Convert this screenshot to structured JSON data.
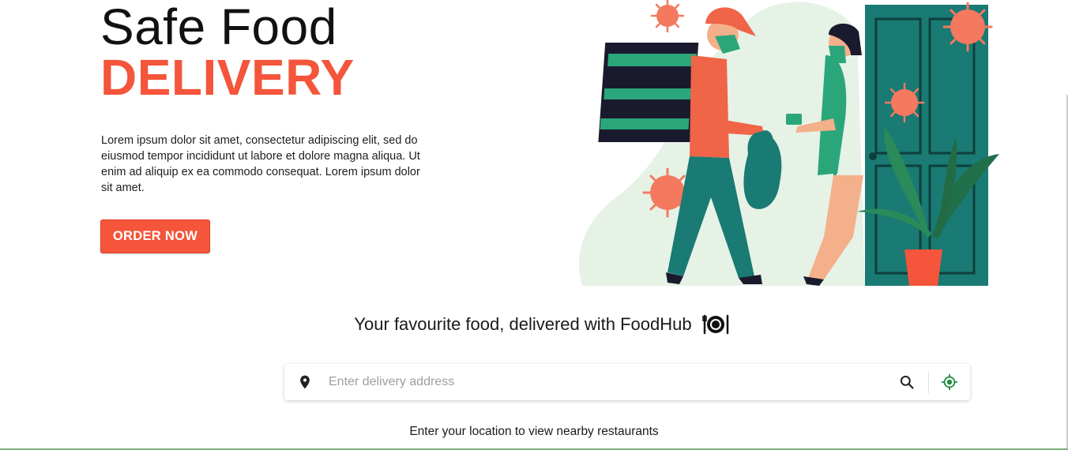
{
  "hero": {
    "title_line1": "Safe Food",
    "title_line2": "DELIVERY",
    "description": "Lorem ipsum dolor sit amet, consectetur adipiscing elit, sed do eiusmod tempor incididunt ut labore et dolore magna aliqua. Ut enim ad aliquip ex ea commodo consequat. Lorem ipsum dolor sit amet.",
    "order_button_label": "ORDER NOW",
    "accent_color": "#f4553b"
  },
  "illustration": {
    "subject": "masked courier handing a food bag to a masked woman at a teal door, with virus particles and a potted plant"
  },
  "search": {
    "tagline": "Your favourite food, delivered with FoodHub",
    "tagline_icon": "plate-with-cutlery-icon",
    "address_placeholder": "Enter delivery address",
    "address_value": "",
    "leading_icon": "location-pin-icon",
    "search_icon": "search-icon",
    "locate_icon": "gps-locate-icon",
    "locate_color": "#1e8e3e",
    "helper_text": "Enter your location to view nearby restaurants"
  }
}
